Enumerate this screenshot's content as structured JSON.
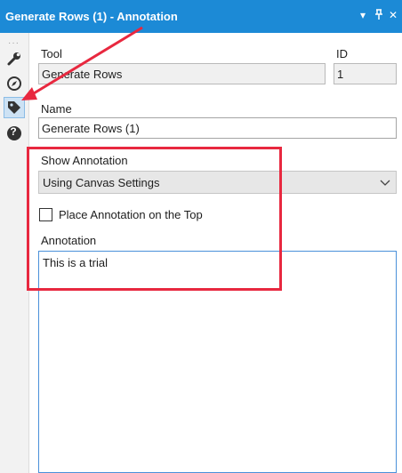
{
  "window": {
    "title": "Generate Rows (1) - Annotation",
    "dropdown_glyph": "▾",
    "pin_glyph": "⊥",
    "close_glyph": "✕"
  },
  "sidebar": {
    "items": [
      {
        "icon": "wrench-icon"
      },
      {
        "icon": "compass-icon"
      },
      {
        "icon": "tag-icon",
        "active": true
      },
      {
        "icon": "help-icon",
        "glyph": "?"
      }
    ]
  },
  "form": {
    "tool_label": "Tool",
    "tool_value": "Generate Rows",
    "id_label": "ID",
    "id_value": "1",
    "name_label": "Name",
    "name_value": "Generate Rows (1)",
    "show_annotation_label": "Show Annotation",
    "show_annotation_value": "Using Canvas Settings",
    "place_on_top_label": "Place Annotation on the Top",
    "place_on_top_checked": false,
    "annotation_label": "Annotation",
    "annotation_value": "This is a trial"
  },
  "colors": {
    "titlebar": "#1c8ad6",
    "highlight": "#e8283f",
    "focus_border": "#4a90d9"
  }
}
